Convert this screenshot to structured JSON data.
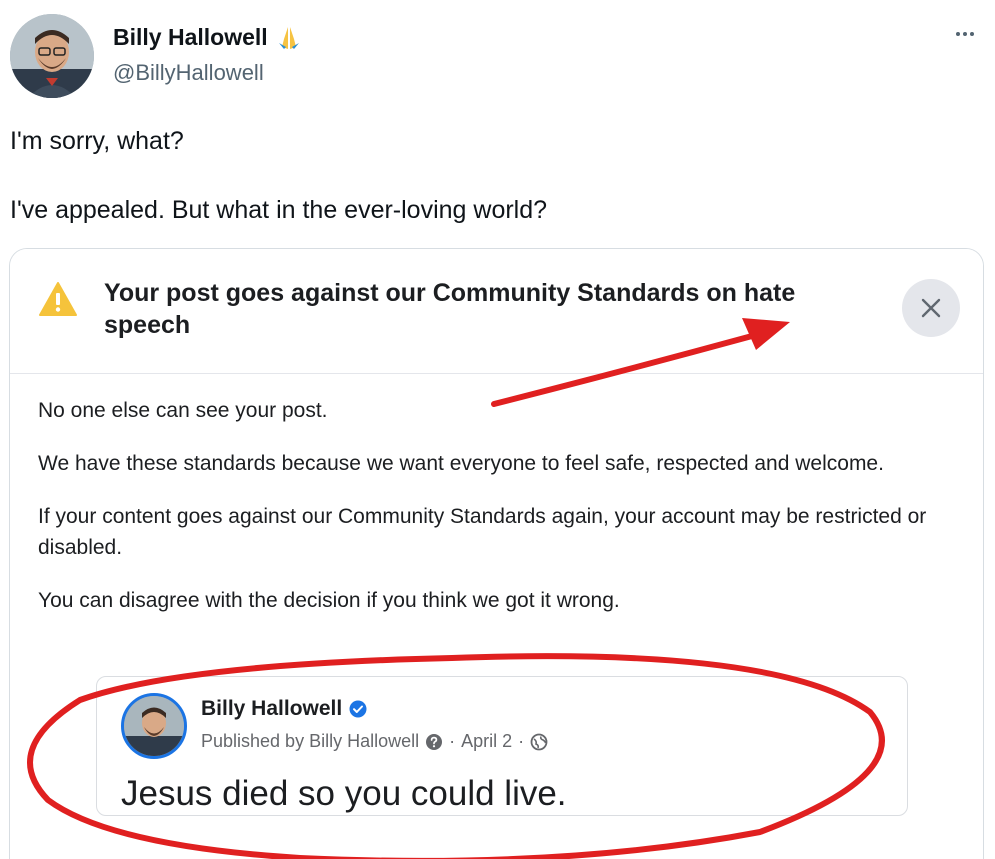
{
  "tweet": {
    "author_name": "Billy Hallowell",
    "author_handle": "@BillyHallowell",
    "lines": [
      "I'm sorry, what?",
      "I've appealed. But what in the ever-loving world?"
    ],
    "more_icon": "ellipsis-icon",
    "name_emoji_icon": "folded-hands-icon"
  },
  "notice": {
    "title": "Your post goes against our Community Standards on hate speech",
    "warning_icon": "warning-triangle-icon",
    "close_icon": "close-x-icon",
    "paragraphs": [
      "No one else can see your post.",
      "We have these standards because we want everyone to feel safe, respected and welcome.",
      "If your content goes against our Community Standards again, your account may be restricted or disabled.",
      "You can disagree with the decision if you think we got it wrong."
    ]
  },
  "post": {
    "author_name": "Billy Hallowell",
    "published_by": "Published by Billy Hallowell",
    "date": "April 2",
    "text": "Jesus died so you could live."
  },
  "colors": {
    "annotation_red": "#e02020",
    "warning_yellow": "#f5c33b",
    "verified_blue": "#1b74e4",
    "handle_gray": "#536471"
  }
}
